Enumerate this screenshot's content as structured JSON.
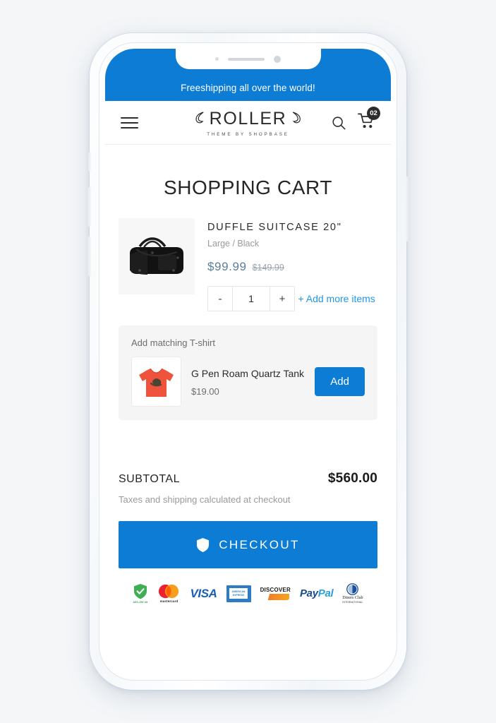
{
  "announcement": {
    "text": "Freeshipping all over the world!"
  },
  "header": {
    "menu_icon": "hamburger-menu-icon",
    "brand_name": "ROLLER",
    "brand_tagline": "THEME BY SHOPBASE",
    "search_icon": "search-icon",
    "cart_icon": "shopping-cart-icon",
    "cart_count": "02"
  },
  "page": {
    "title": "SHOPPING CART"
  },
  "cart_item": {
    "image_alt": "black-duffle-bag",
    "title": "DUFFLE SUITCASE 20\"",
    "variant": "Large / Black",
    "price": "$99.99",
    "compare_at_price": "$149.99",
    "qty_decrease_label": "-",
    "qty_value": "1",
    "qty_increase_label": "+",
    "add_more_label": "+ Add more items"
  },
  "upsell": {
    "heading": "Add matching T-shirt",
    "image_alt": "orange-t-shirt",
    "product_name": "G Pen Roam Quartz Tank",
    "price": "$19.00",
    "add_button_label": "Add"
  },
  "totals": {
    "subtotal_label": "SUBTOTAL",
    "subtotal_amount": "$560.00",
    "tax_note": "Taxes and shipping calculated at checkout",
    "checkout_label": "CHECKOUT",
    "checkout_icon": "shield-icon"
  },
  "payment_badges": [
    {
      "name": "secure-ssl-badge",
      "caption": "AES-256 bit"
    },
    {
      "name": "mastercard-badge",
      "caption": "mastercard"
    },
    {
      "name": "visa-badge",
      "caption": "VISA"
    },
    {
      "name": "american-express-badge",
      "line1": "AMERICAN",
      "line2": "EXPRESS"
    },
    {
      "name": "discover-badge",
      "caption": "DISCOVER"
    },
    {
      "name": "paypal-badge",
      "part1": "Pay",
      "part2": "Pal"
    },
    {
      "name": "diners-club-badge",
      "caption": "Diners Club",
      "sub": "INTERNATIONAL"
    }
  ],
  "colors": {
    "brand_blue": "#0c7cd5",
    "link_blue": "#2196e8",
    "sale_price": "#5b7d9c",
    "page_bg": "#f4f6f8"
  }
}
